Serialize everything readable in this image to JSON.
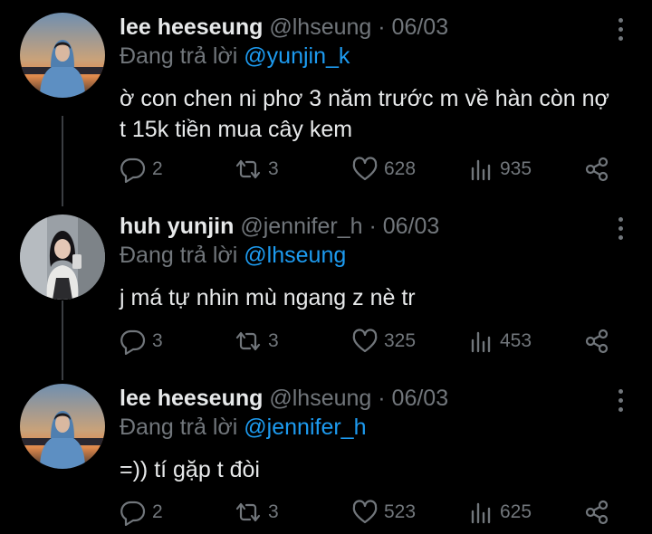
{
  "reply_prefix": "Đang trả lời",
  "tweets": [
    {
      "name": "lee heeseung",
      "handle": "@lhseung",
      "date": "06/03",
      "reply_to": "@yunjin_k",
      "text_lines": [
        "ờ con chen ni phơ 3 năm trước m về hàn còn nợ",
        "t 15k tiền mua cây kem"
      ],
      "replies": "2",
      "retweets": "3",
      "likes": "628",
      "views": "935"
    },
    {
      "name": "huh yunjin",
      "handle": "@jennifer_h",
      "date": "06/03",
      "reply_to": "@lhseung",
      "text_lines": [
        "j má tự nhin mù ngang z nè tr"
      ],
      "replies": "3",
      "retweets": "3",
      "likes": "325",
      "views": "453"
    },
    {
      "name": "lee heeseung",
      "handle": "@lhseung",
      "date": "06/03",
      "reply_to": "@jennifer_h",
      "text_lines": [
        "=)) tí gặp t đòi"
      ],
      "replies": "2",
      "retweets": "3",
      "likes": "523",
      "views": "625"
    }
  ],
  "icons": {
    "reply": "reply-bubble-icon",
    "retweet": "retweet-arrows-icon",
    "like": "heart-icon",
    "views": "views-bar-chart-icon",
    "share": "share-icon",
    "more": "more-vertical-icon"
  },
  "colors": {
    "background": "#000000",
    "text": "#e7e9ea",
    "muted": "#71767b",
    "link": "#1d9bf0",
    "thread_line": "#3a3d41"
  }
}
